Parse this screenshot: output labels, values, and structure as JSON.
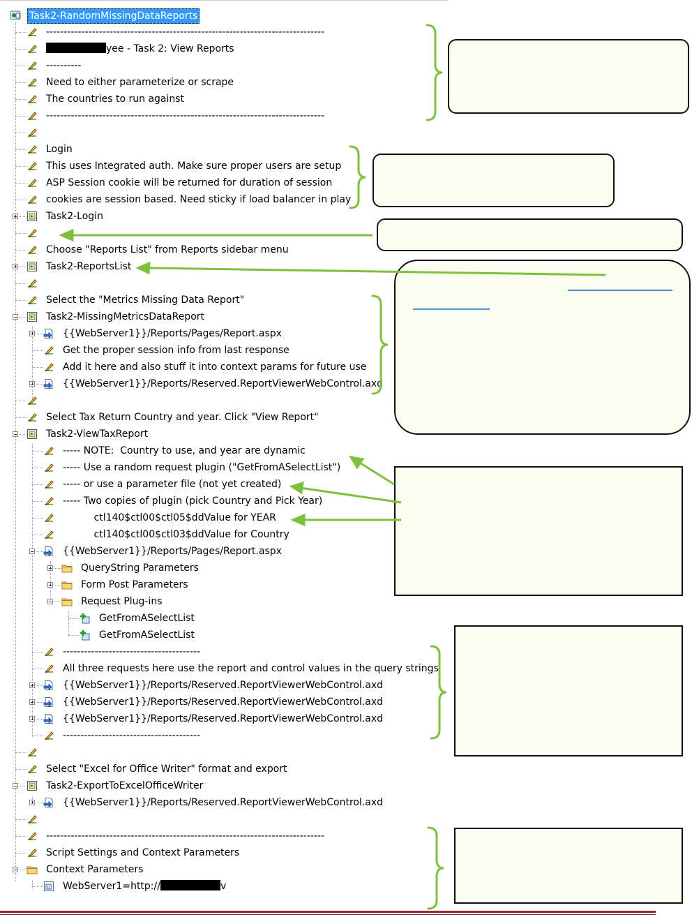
{
  "tree": {
    "root": "Task2-RandomMissingDataReports",
    "rows": [
      {
        "text": "-------------------------------------------------------------------------------"
      },
      {
        "text_suffix": "yee - Task 2: View Reports"
      },
      {
        "text": "----------"
      },
      {
        "text": "Need to either parameterize or scrape"
      },
      {
        "text": "The countries to run against"
      },
      {
        "text": "-------------------------------------------------------------------------------"
      },
      {
        "text": ""
      },
      {
        "text": "Login"
      },
      {
        "text": "This uses Integrated auth. Make sure proper users are setup"
      },
      {
        "text": "ASP Session cookie will be returned for duration of session"
      },
      {
        "text": "cookies are session based. Need sticky if load balancer in play"
      },
      {
        "text": "Task2-Login"
      },
      {
        "text": ""
      },
      {
        "text": "Choose \"Reports List\" from Reports sidebar menu"
      },
      {
        "text": "Task2-ReportsList"
      },
      {
        "text": ""
      },
      {
        "text": "Select the \"Metrics Missing Data Report\""
      },
      {
        "text": "Task2-MissingMetricsDataReport"
      },
      {
        "text": "{{WebServer1}}/Reports/Pages/Report.aspx"
      },
      {
        "text": "Get the proper session info from last response"
      },
      {
        "text": "Add it here and also stuff it into context params for future use"
      },
      {
        "text": "{{WebServer1}}/Reports/Reserved.ReportViewerWebControl.axd"
      },
      {
        "text": ""
      },
      {
        "text": "Select Tax Return Country and year. Click \"View Report\""
      },
      {
        "text": "Task2-ViewTaxReport"
      },
      {
        "text": "----- NOTE:  Country to use, and year are dynamic"
      },
      {
        "text": "----- Use a random request plugin (\"GetFromASelectList\")"
      },
      {
        "text": "----- or use a parameter file (not yet created)"
      },
      {
        "text": "----- Two copies of plugin (pick Country and Pick Year)"
      },
      {
        "text": "          ctl140$ctl00$ctl05$ddValue for YEAR"
      },
      {
        "text": "          ctl140$ctl00$ctl03$ddValue for Country"
      },
      {
        "text": "{{WebServer1}}/Reports/Pages/Report.aspx"
      },
      {
        "text": "QueryString Parameters"
      },
      {
        "text": "Form Post Parameters"
      },
      {
        "text": "Request Plug-ins"
      },
      {
        "text": "GetFromASelectList"
      },
      {
        "text": "GetFromASelectList"
      },
      {
        "text": "---------------------------------------"
      },
      {
        "text": "All three requests here use the report and control values in the query strings"
      },
      {
        "text": "{{WebServer1}}/Reports/Reserved.ReportViewerWebControl.axd"
      },
      {
        "text": "{{WebServer1}}/Reports/Reserved.ReportViewerWebControl.axd"
      },
      {
        "text": "{{WebServer1}}/Reports/Reserved.ReportViewerWebControl.axd"
      },
      {
        "text": "---------------------------------------"
      },
      {
        "text": ""
      },
      {
        "text": "Select \"Excel for Office Writer\" format and export"
      },
      {
        "text": "Task2-ExportToExcelOfficeWriter"
      },
      {
        "text": "{{WebServer1}}/Reports/Reserved.ReportViewerWebControl.axd"
      },
      {
        "text": ""
      },
      {
        "text": "-------------------------------------------------------------------------------"
      },
      {
        "text": "Script Settings and Context Parameters"
      },
      {
        "text": "Context Parameters"
      },
      {
        "text_prefix": "WebServer1=http://",
        "text_suffix": "v"
      }
    ]
  },
  "icons": {
    "root": "webtest-icon",
    "comment": "comment-pencil-icon",
    "transaction": "transaction-icon",
    "request": "request-icon",
    "folder": "folder-icon",
    "plugin": "plugin-icon",
    "parameter": "context-parameter-icon"
  },
  "colors": {
    "accent": "#7dc13f",
    "note_fill": "#fafdf0",
    "selection": "#3399ff",
    "footer": "#8b2b2b"
  }
}
